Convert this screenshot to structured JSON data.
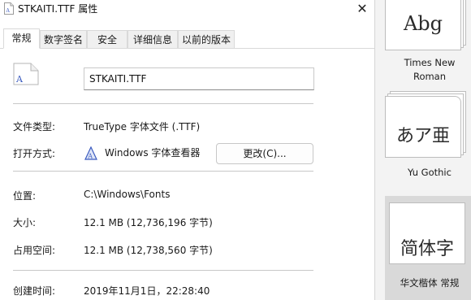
{
  "window": {
    "title": "STKAITI.TTF 属性",
    "close_glyph": "✕"
  },
  "tabs": [
    {
      "label": "常规",
      "active": true
    },
    {
      "label": "数字签名",
      "active": false
    },
    {
      "label": "安全",
      "active": false
    },
    {
      "label": "详细信息",
      "active": false
    },
    {
      "label": "以前的版本",
      "active": false
    }
  ],
  "general": {
    "file_name": "STKAITI.TTF",
    "file_type_label": "文件类型:",
    "file_type_value": "TrueType 字体文件 (.TTF)",
    "open_with_label": "打开方式:",
    "open_with_app": "Windows 字体查看器",
    "change_button": "更改(C)...",
    "location_label": "位置:",
    "location_value": "C:\\Windows\\Fonts",
    "size_label": "大小:",
    "size_value": "12.1 MB (12,736,196 字节)",
    "disk_size_label": "占用空间:",
    "disk_size_value": "12.1 MB (12,738,560 字节)",
    "created_label": "创建时间:",
    "created_value": "2019年11月1日，22:28:40"
  },
  "gallery": [
    {
      "sample": "Abg",
      "name": "Times New Roman",
      "name_line1": "Times New",
      "name_line2": "Roman",
      "selected": false
    },
    {
      "sample": "あア亜",
      "name": "Yu Gothic",
      "name_line1": "Yu Gothic",
      "name_line2": "",
      "selected": false
    },
    {
      "sample": "简体字",
      "name": "华文楷体 常规",
      "name_line1": "华文楷体 常规",
      "name_line2": "",
      "selected": true
    }
  ],
  "colors": {
    "file_icon_glyph": "#3b5bbf",
    "app_icon": "#3b5bbf"
  },
  "icons": {
    "title": "font-file-icon",
    "file": "font-file-icon",
    "app": "font-viewer-icon"
  }
}
